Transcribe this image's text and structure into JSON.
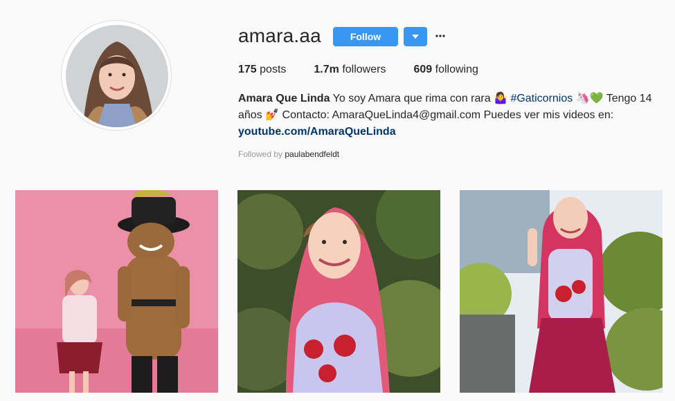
{
  "profile": {
    "username": "amara.aa",
    "follow_label": "Follow",
    "more_glyph": "···",
    "stats": {
      "posts_count": "175",
      "posts_label": "posts",
      "followers_count": "1.7m",
      "followers_label": "followers",
      "following_count": "609",
      "following_label": "following"
    },
    "bio": {
      "name": "Amara Que Linda",
      "text1": "Yo soy Amara que rima con rara 🤷‍♀️",
      "hashtag": "#Gaticornios",
      "text2": "🦄💚 Tengo 14 años 💅 Contacto: AmaraQueLinda4@gmail.com Puedes ver mis videos en:",
      "link": "youtube.com/AmaraQueLinda"
    },
    "followed_by_label": "Followed by",
    "followed_by_user": "paulabendfeldt"
  },
  "colors": {
    "accent": "#3897f0",
    "link": "#003569"
  },
  "icons": [
    "chevron-down-icon",
    "more-options-icon"
  ]
}
